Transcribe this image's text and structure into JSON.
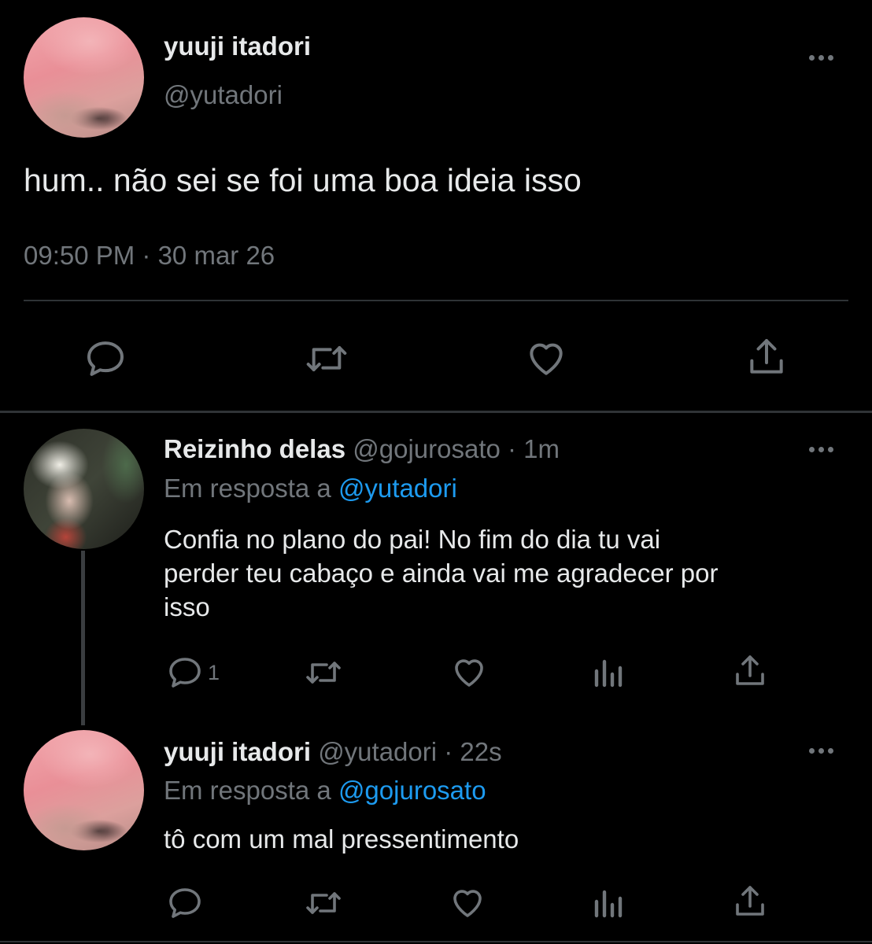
{
  "main_tweet": {
    "display_name": "yuuji itadori",
    "handle": "@yutadori",
    "text": "hum.. não sei se foi uma boa ideia isso",
    "timestamp": "09:50 PM · 30 mar 26"
  },
  "replies": [
    {
      "display_name": "Reizinho delas",
      "handle": "@gojurosato",
      "time": "· 1m",
      "reply_prefix": "Em resposta a",
      "reply_to": "@yutadori",
      "text_lines": [
        "Confia no plano do pai! No fim do dia tu vai",
        "perder teu cabaço e ainda vai me agradecer por",
        "isso"
      ],
      "reply_count": "1"
    },
    {
      "display_name": "yuuji itadori",
      "handle": "@yutadori",
      "time": "· 22s",
      "reply_prefix": "Em resposta a",
      "reply_to": "@gojurosato",
      "text": "tô com um mal pressentimento",
      "reply_count": ""
    }
  ],
  "icons": {
    "reply": "reply-icon",
    "retweet": "retweet-icon",
    "like": "heart-icon",
    "share": "share-icon",
    "views": "analytics-icon",
    "more": "more-icon"
  },
  "colors": {
    "background": "#000000",
    "text": "#e7e9ea",
    "muted": "#71767b",
    "link": "#1d9bf0"
  }
}
